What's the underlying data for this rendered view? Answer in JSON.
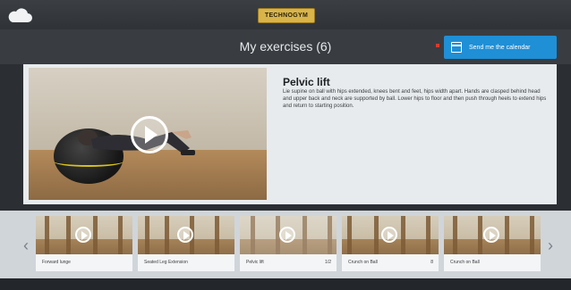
{
  "app": {
    "logo_text": "TECHNOGYM",
    "title": "My exercises (6)",
    "calendar_button": "Send me the calendar"
  },
  "exercise": {
    "name": "Pelvic lift",
    "description": "Lie supine on ball with hips extended, knees bent and feet, hips width apart. Hands are clasped behind head and upper back and neck are supported by ball. Lower hips to floor and then push through heels to extend hips and return to starting position."
  },
  "thumbnails": [
    {
      "label": "Forward lunge",
      "number": ""
    },
    {
      "label": "Seated Leg Extension",
      "number": ""
    },
    {
      "label": "Pelvic lift",
      "number": "1/2"
    },
    {
      "label": "Crunch on Ball",
      "number": "8"
    },
    {
      "label": "Crunch on Ball",
      "number": ""
    }
  ],
  "colors": {
    "accent": "#1f8fd6",
    "header": "#393d42"
  }
}
